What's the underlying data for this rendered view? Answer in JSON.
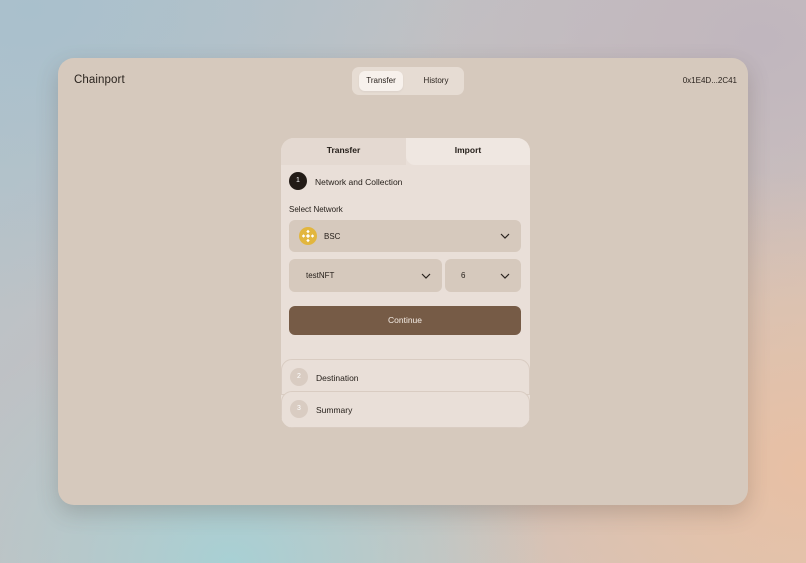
{
  "app": {
    "brand": "Chainport",
    "address": "0x1E4D...2C41"
  },
  "top_tabs": [
    {
      "label": "Transfer",
      "active": true
    },
    {
      "label": "History",
      "active": false
    }
  ],
  "card": {
    "tabs": [
      {
        "label": "Transfer",
        "active": true
      },
      {
        "label": "Import",
        "active": false
      }
    ],
    "steps": [
      {
        "number": "1",
        "label": "Network and Collection",
        "active": true
      },
      {
        "number": "2",
        "label": "Destination",
        "active": false
      },
      {
        "number": "3",
        "label": "Summary",
        "active": false
      }
    ],
    "network": {
      "label": "Select Network",
      "value": "BSC",
      "icon": "bnb-coin-icon"
    },
    "collection": {
      "value": "testNFT"
    },
    "token_id": {
      "value": "6"
    },
    "continue_label": "Continue"
  },
  "colors": {
    "window_bg": "#d6c9bd",
    "card_bg": "#e9dfd8",
    "accent_button": "#765b46",
    "step_active": "#221b16",
    "coin": "#e2b63e"
  }
}
